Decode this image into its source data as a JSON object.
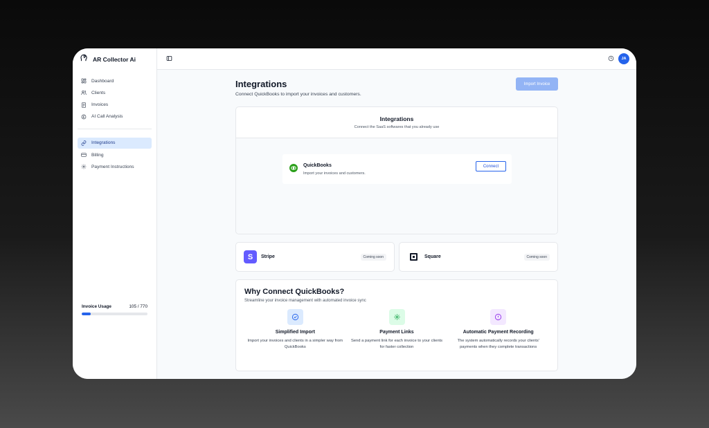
{
  "app": {
    "name": "AR Collector Ai",
    "logo_icon": "head-logo-icon"
  },
  "sidebar": {
    "items": [
      {
        "label": "Dashboard",
        "icon": "dashboard-grid-icon",
        "active": false
      },
      {
        "label": "Clients",
        "icon": "users-icon",
        "active": false
      },
      {
        "label": "Invoices",
        "icon": "invoice-doc-icon",
        "active": false
      },
      {
        "label": "AI Call Analysis",
        "icon": "ai-analysis-icon",
        "active": false
      }
    ],
    "items2": [
      {
        "label": "Integrations",
        "icon": "link-icon",
        "active": true
      },
      {
        "label": "Billing",
        "icon": "credit-card-icon",
        "active": false
      },
      {
        "label": "Payment Instructions",
        "icon": "gear-icon",
        "active": false
      }
    ],
    "usage": {
      "label": "Invoice Usage",
      "value": "105 / 770",
      "used": 105,
      "total": 770
    }
  },
  "topbar": {
    "avatar_initials": "JA"
  },
  "page": {
    "title": "Integrations",
    "subtitle": "Connect QuickBooks to import your invoices and customers.",
    "import_button": "Import Invoice"
  },
  "integrations_card": {
    "title": "Integrations",
    "subtitle": "Connect the SaaS softwares that you already use",
    "quickbooks": {
      "name": "QuickBooks",
      "description": "Import your invoices and customers.",
      "connect_label": "Connect"
    }
  },
  "providers": [
    {
      "name": "Stripe",
      "badge": "Coming soon"
    },
    {
      "name": "Square",
      "badge": "Coming soon"
    }
  ],
  "why": {
    "title": "Why Connect QuickBooks?",
    "subtitle": "Streamline your invoice management with automated invoice sync",
    "features": [
      {
        "title": "Simplified Import",
        "description": "Import your invoices and clients in a simpler way from QuickBooks",
        "icon": "check-circle-icon"
      },
      {
        "title": "Payment Links",
        "description": "Send a payment link for each invoice to your clients for faster collection",
        "icon": "gear-icon"
      },
      {
        "title": "Automatic Payment Recording",
        "description": "The system automatically records your clients' payments when they complete transactions",
        "icon": "alert-circle-icon"
      }
    ]
  },
  "colors": {
    "accent": "#2563eb",
    "active_nav_bg": "#dbeafe",
    "quickbooks_green": "#2ca01c",
    "stripe_purple": "#635bff",
    "feature1_bg": "#dbeafe",
    "feature2_bg": "#dcfce7",
    "feature3_bg": "#f3e8ff"
  }
}
